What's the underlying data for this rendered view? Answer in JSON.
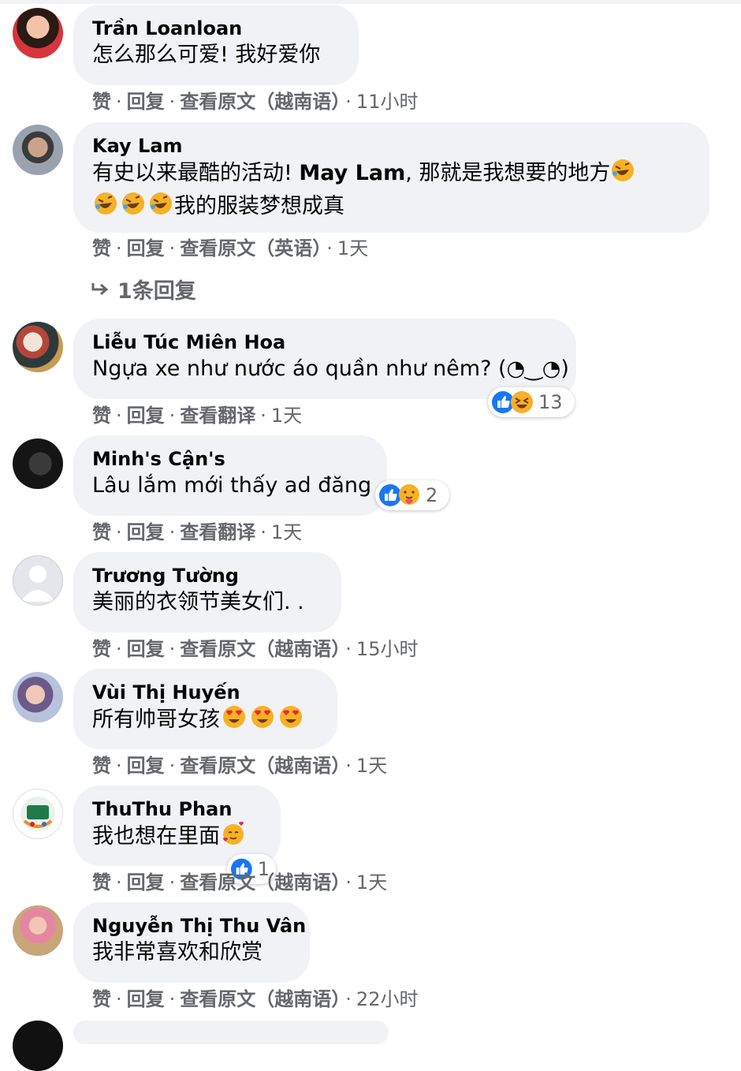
{
  "actions": {
    "like": "赞",
    "reply": "回复",
    "sep": "·",
    "see_original_vi": "查看原文（越南语）",
    "see_original_en": "查看原文（英语）",
    "see_translation": "查看翻译"
  },
  "comments": [
    {
      "author": "Trần Loanloan",
      "text": "怎么那么可爱! 我好爱你",
      "time": "11小时"
    },
    {
      "author": "Kay Lam",
      "line1_prefix": "有史以来最酷的活动! ",
      "tag": "May Lam",
      "line1_suffix": ", 那就是我想要的地方",
      "line2": "我的服装梦想成真",
      "time": "1天",
      "replies": "1条回复"
    },
    {
      "author": "Liễu Túc Miên Hoa",
      "text": "Ngựa xe như nước áo quần như nêm? (◔‿◔)",
      "time": "1天",
      "reactions": "13"
    },
    {
      "author": "Minh's Cận's",
      "text": "Lâu lắm mới thấy ad đăng",
      "time": "1天",
      "reactions": "2"
    },
    {
      "author": "Trương Tường",
      "text": "美丽的衣领节美女们. .",
      "time": "15小时"
    },
    {
      "author": "Vùi Thị Huyến",
      "text": "所有帅哥女孩",
      "time": "1天"
    },
    {
      "author": "ThuThu Phan",
      "text": "我也想在里面",
      "time": "1天",
      "reactions": "1"
    },
    {
      "author": "Nguyễn Thị Thu Vân",
      "text": "我非常喜欢和欣赏",
      "time": "22小时"
    }
  ],
  "colors": {
    "bubble": "#f0f2f5",
    "meta": "#65676b",
    "like_blue": "#1877f2",
    "emoji_yellow": "#f7b125"
  }
}
